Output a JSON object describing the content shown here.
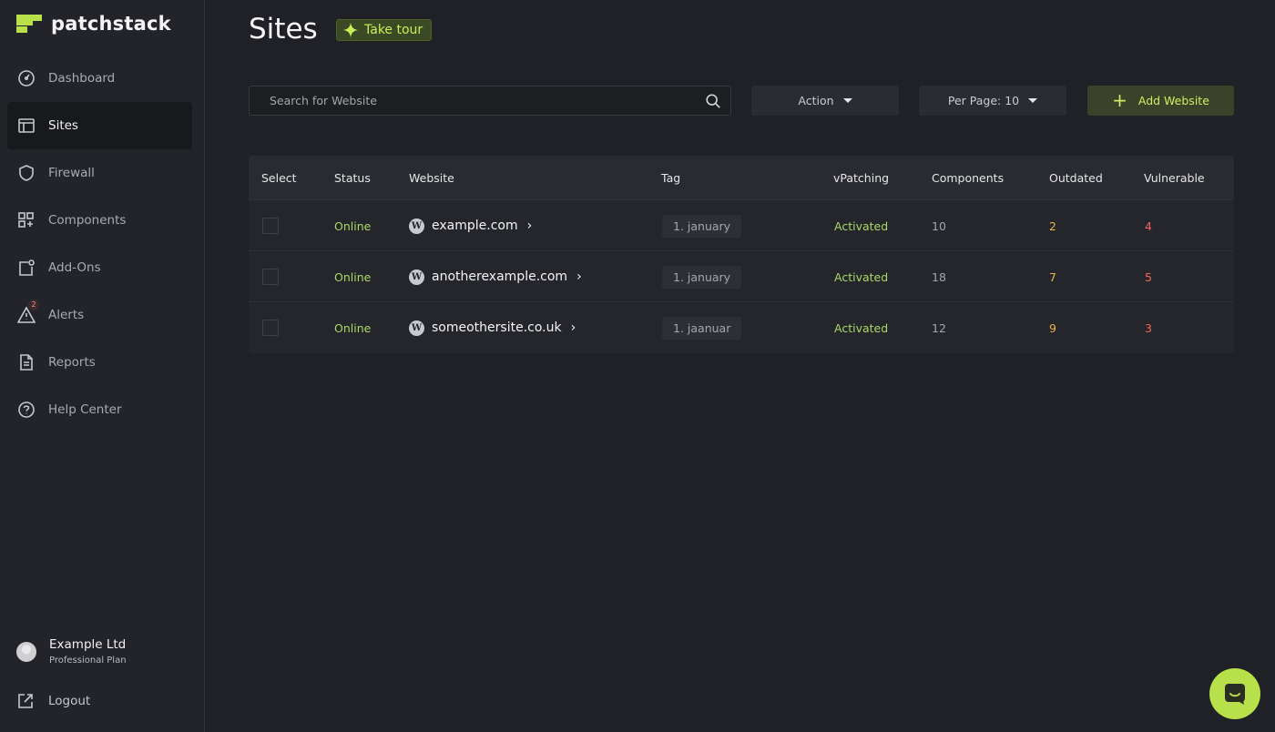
{
  "brand": {
    "name": "patchstack"
  },
  "sidebar": {
    "items": [
      {
        "label": "Dashboard",
        "icon": "dashboard-icon"
      },
      {
        "label": "Sites",
        "icon": "sites-icon",
        "active": true
      },
      {
        "label": "Firewall",
        "icon": "shield-icon"
      },
      {
        "label": "Components",
        "icon": "components-icon"
      },
      {
        "label": "Add-Ons",
        "icon": "addons-icon"
      },
      {
        "label": "Alerts",
        "icon": "alert-icon",
        "badge": "2"
      },
      {
        "label": "Reports",
        "icon": "report-icon"
      },
      {
        "label": "Help Center",
        "icon": "help-icon"
      }
    ],
    "account": {
      "name": "Example Ltd",
      "plan": "Professional Plan"
    },
    "logout_label": "Logout"
  },
  "header": {
    "title": "Sites",
    "tour_label": "Take tour"
  },
  "toolbar": {
    "search_placeholder": "Search for Website",
    "action_label": "Action",
    "per_page_label": "Per Page: 10",
    "add_label": "Add Website"
  },
  "table": {
    "columns": [
      "Select",
      "Status",
      "Website",
      "Tag",
      "vPatching",
      "Components",
      "Outdated",
      "Vulnerable"
    ],
    "rows": [
      {
        "status": "Online",
        "website": "example.com",
        "tag": "1. january",
        "vpatching": "Activated",
        "components": "10",
        "outdated": "2",
        "vulnerable": "4"
      },
      {
        "status": "Online",
        "website": "anotherexample.com",
        "tag": "1. january",
        "vpatching": "Activated",
        "components": "18",
        "outdated": "7",
        "vulnerable": "5"
      },
      {
        "status": "Online",
        "website": "someothersite.co.uk",
        "tag": "1. jaanuar",
        "vpatching": "Activated",
        "components": "12",
        "outdated": "9",
        "vulnerable": "3"
      }
    ]
  },
  "colors": {
    "accent": "#b7e04a",
    "online": "#a9d86a",
    "outdated": "#e7b34a",
    "vulnerable": "#f0665e"
  }
}
